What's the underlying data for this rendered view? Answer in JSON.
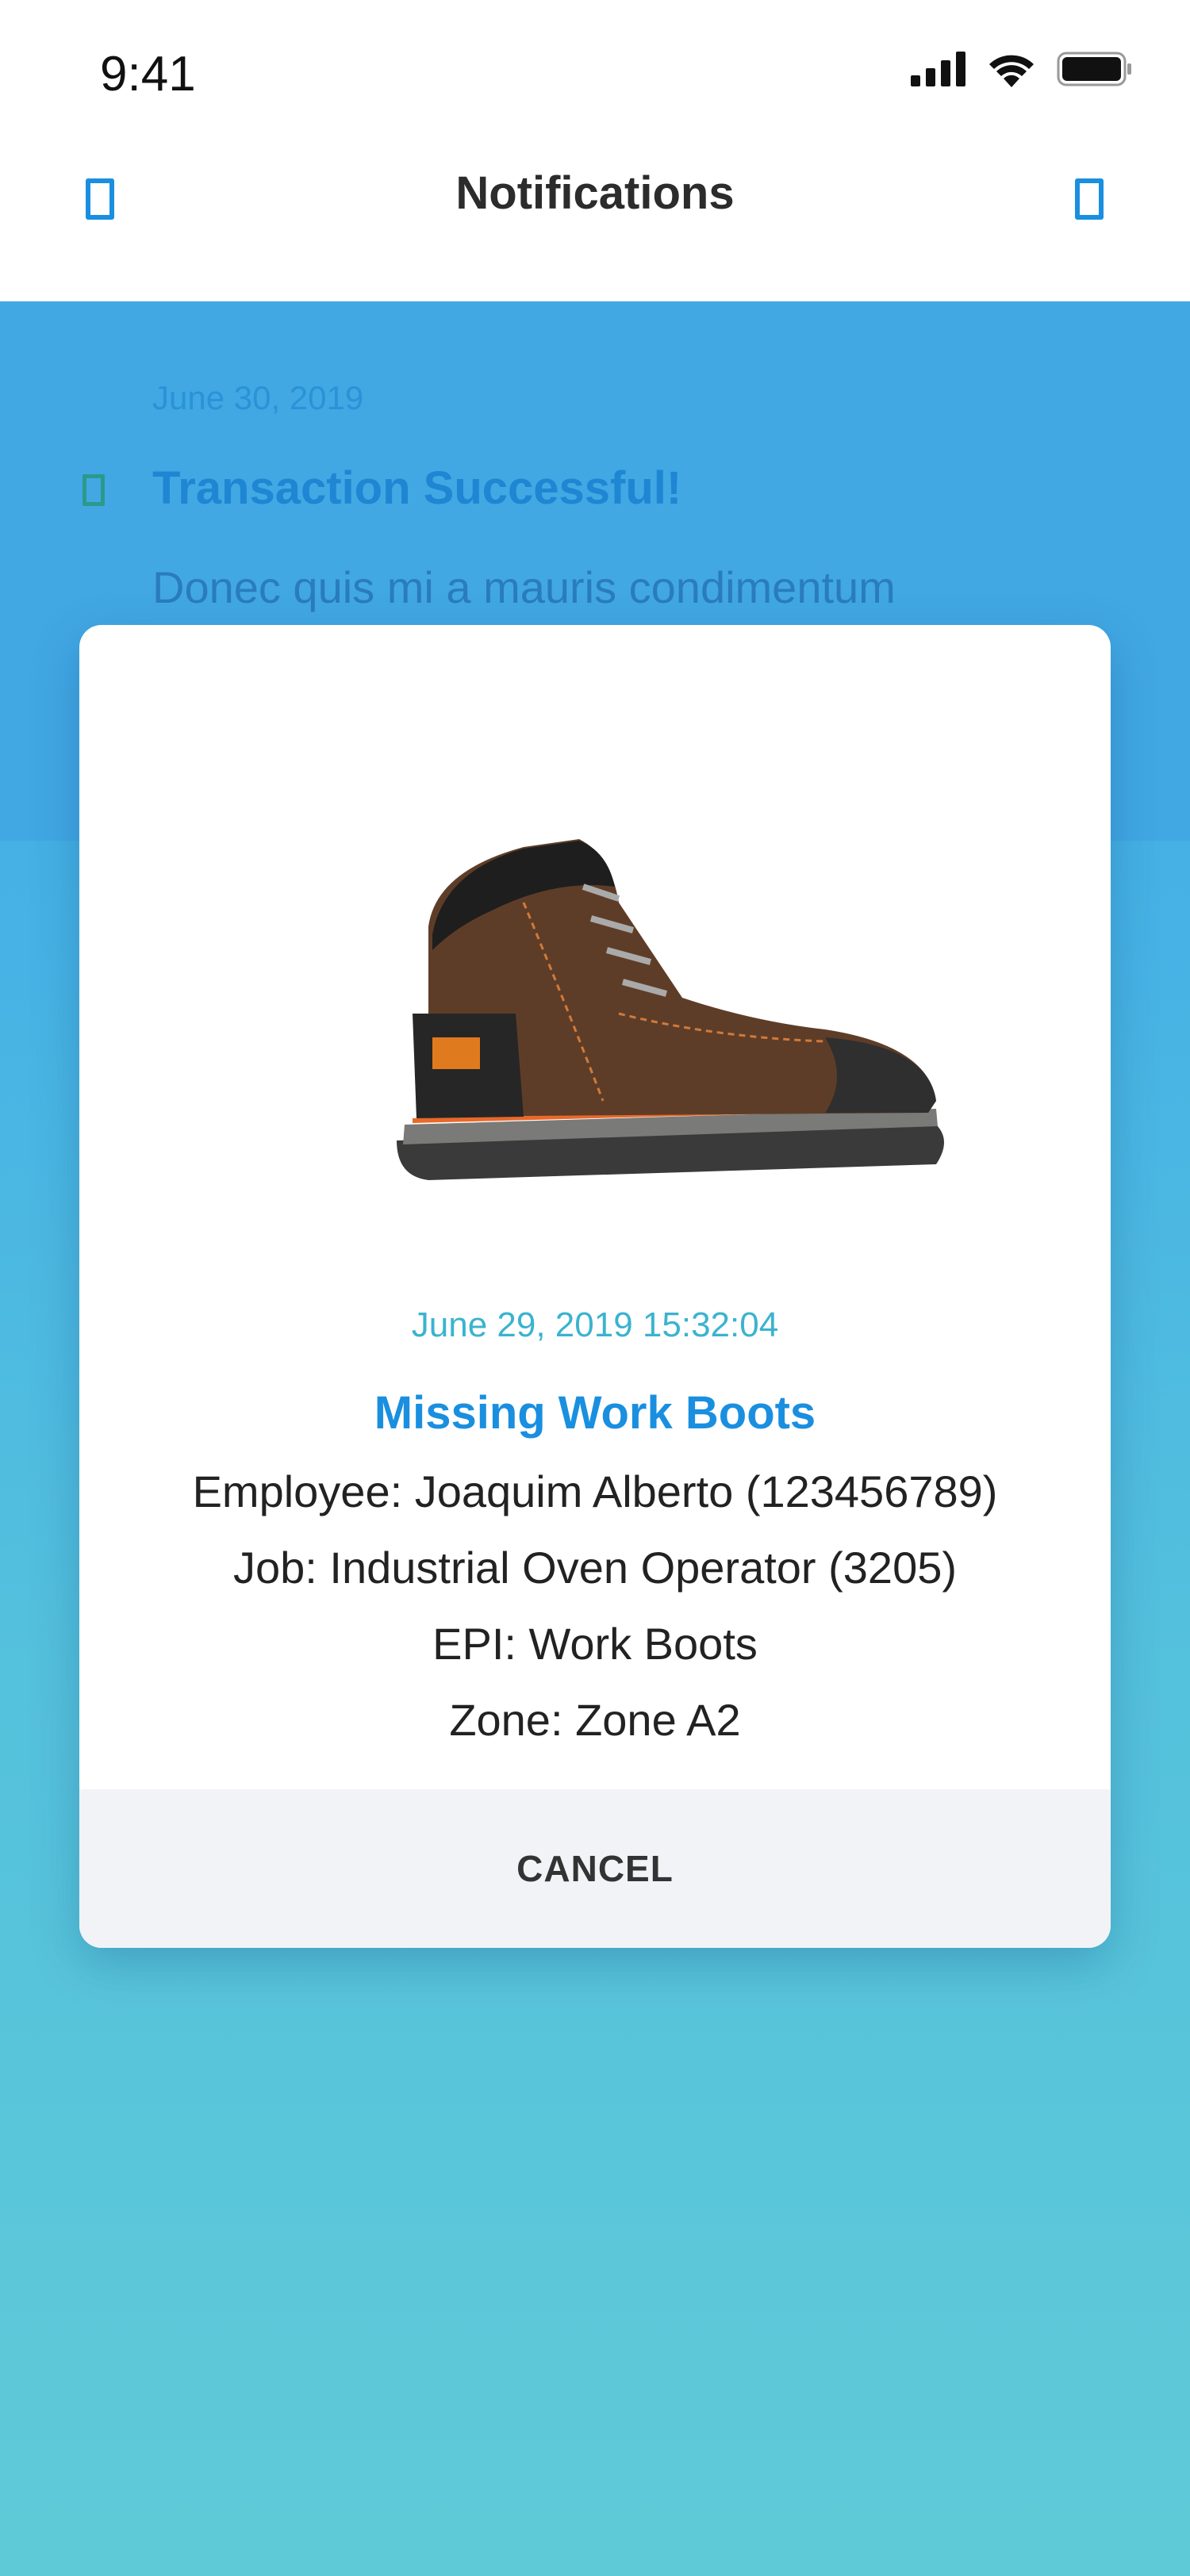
{
  "status_bar": {
    "time": "9:41"
  },
  "header": {
    "title": "Notifications",
    "left_icon": "back-icon",
    "right_icon": "action-icon"
  },
  "list": {
    "items": [
      {
        "date": "June 30, 2019",
        "title": "Transaction Successful!",
        "body": "Donec quis mi a mauris condimentum",
        "icon": "notification-icon"
      }
    ]
  },
  "modal": {
    "image": "work-boot-image",
    "timestamp": "June 29, 2019 15:32:04",
    "title": "Missing Work Boots",
    "details": [
      "Employee: Joaquim Alberto (123456789)",
      "Job: Industrial Oven Operator (3205)",
      "EPI: Work Boots",
      "Zone: Zone A2"
    ],
    "cancel_label": "CANCEL"
  },
  "colors": {
    "accent": "#1a8fe0",
    "timestamp": "#3bb3cf",
    "gradient_top": "#3ba7e3",
    "gradient_bottom": "#5fcad7"
  }
}
